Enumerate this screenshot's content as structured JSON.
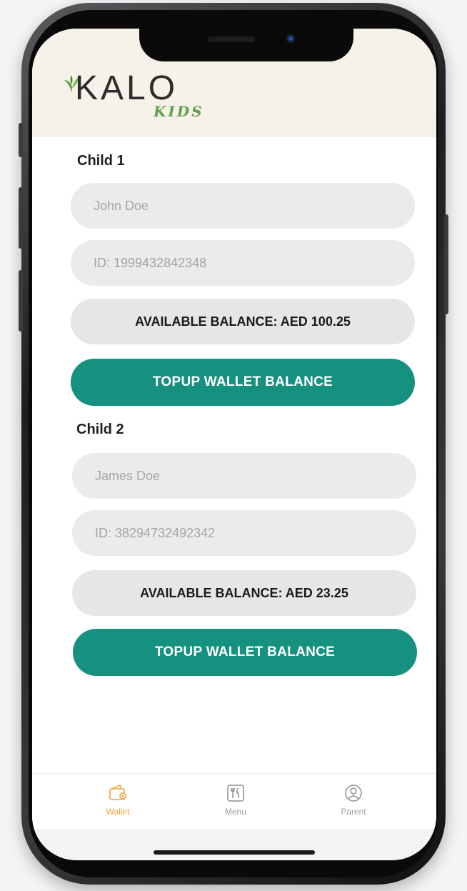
{
  "app": {
    "logo_text": "KALO",
    "logo_sub": "KIDS"
  },
  "children": [
    {
      "title": "Child 1",
      "name_placeholder": "John Doe",
      "id_placeholder": "ID: 1999432842348",
      "balance_text": "AVAILABLE BALANCE: AED 100.25",
      "topup_label": "TOPUP WALLET BALANCE"
    },
    {
      "title": "Child 2",
      "name_placeholder": "James Doe",
      "id_placeholder": "ID: 38294732492342",
      "balance_text": "AVAILABLE BALANCE: AED 23.25",
      "topup_label": "TOPUP WALLET BALANCE"
    }
  ],
  "tabs": [
    {
      "label": "Wallet",
      "icon": "wallet-icon",
      "active": true
    },
    {
      "label": "Menu",
      "icon": "menu-icon",
      "active": false
    },
    {
      "label": "Parent",
      "icon": "user-circle-icon",
      "active": false
    }
  ],
  "colors": {
    "accent": "#16917f",
    "active_tab": "#f0a23a",
    "inactive_tab": "#9a9a9a",
    "header_bg": "#f6f2ea",
    "logo_green": "#5fa04a"
  }
}
